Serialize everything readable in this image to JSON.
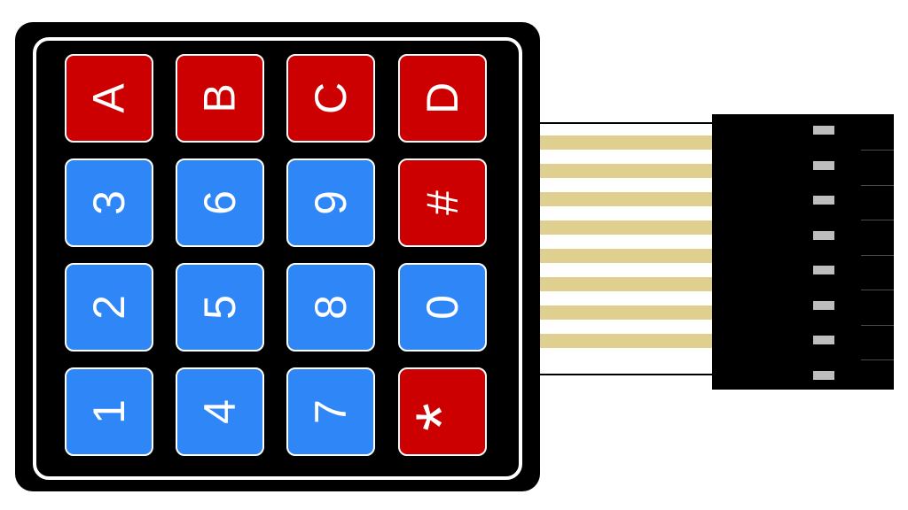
{
  "keypad": {
    "rows": [
      [
        {
          "label": "A",
          "color": "#cc0000"
        },
        {
          "label": "B",
          "color": "#cc0000"
        },
        {
          "label": "C",
          "color": "#cc0000"
        },
        {
          "label": "D",
          "color": "#cc0000"
        }
      ],
      [
        {
          "label": "3",
          "color": "#2f86f7"
        },
        {
          "label": "6",
          "color": "#2f86f7"
        },
        {
          "label": "9",
          "color": "#2f86f7"
        },
        {
          "label": "#",
          "color": "#cc0000"
        }
      ],
      [
        {
          "label": "2",
          "color": "#2f86f7"
        },
        {
          "label": "5",
          "color": "#2f86f7"
        },
        {
          "label": "8",
          "color": "#2f86f7"
        },
        {
          "label": "0",
          "color": "#2f86f7"
        }
      ],
      [
        {
          "label": "1",
          "color": "#2f86f7"
        },
        {
          "label": "4",
          "color": "#2f86f7"
        },
        {
          "label": "7",
          "color": "#2f86f7"
        },
        {
          "label": "*",
          "color": "#cc0000"
        }
      ]
    ]
  },
  "ribbon": {
    "trace_count": 8,
    "trace_color": "#e0d08f"
  },
  "connector": {
    "pin_count": 8,
    "pin_color": "#bdbdbd"
  },
  "colors": {
    "body": "#000000",
    "red_key": "#cc0000",
    "blue_key": "#2f86f7"
  }
}
